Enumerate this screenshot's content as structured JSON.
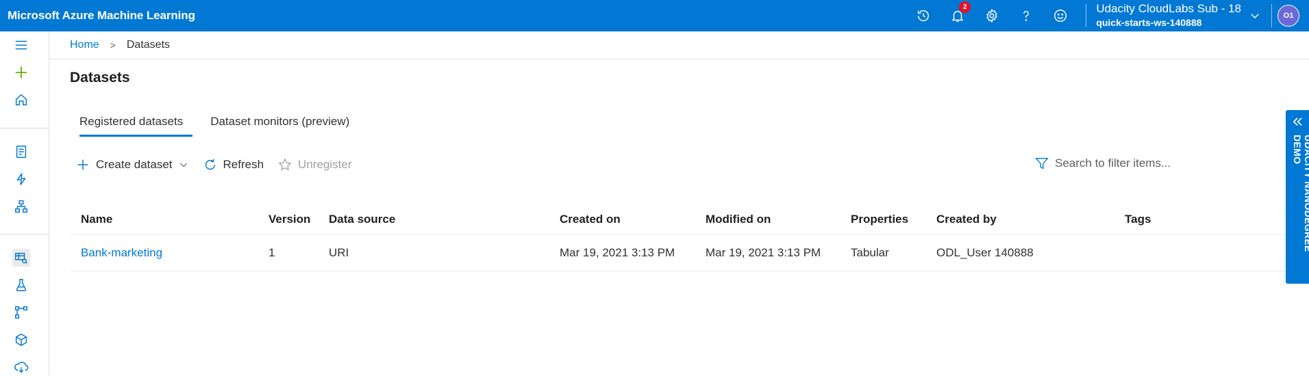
{
  "app": {
    "title": "Microsoft Azure Machine Learning"
  },
  "header": {
    "notification_count": "2",
    "account_subscription": "Udacity CloudLabs Sub - 18",
    "account_workspace": "quick-starts-ws-140888",
    "avatar_initials": "O1",
    "icons": [
      "history-icon",
      "notification-bell-icon",
      "settings-gear-icon",
      "help-question-icon",
      "feedback-smiley-icon",
      "chevron-down-icon"
    ]
  },
  "breadcrumb": {
    "home": "Home",
    "separator": ">",
    "current": "Datasets"
  },
  "page": {
    "title": "Datasets"
  },
  "tabs": [
    {
      "label": "Registered datasets",
      "active": true
    },
    {
      "label": "Dataset monitors (preview)",
      "active": false
    }
  ],
  "toolbar": {
    "create_label": "Create dataset",
    "refresh_label": "Refresh",
    "unregister_label": "Unregister"
  },
  "search": {
    "placeholder": "Search to filter items..."
  },
  "table": {
    "columns": [
      "Name",
      "Version",
      "Data source",
      "Created on",
      "Modified on",
      "Properties",
      "Created by",
      "Tags"
    ],
    "rows": [
      {
        "name": "Bank-marketing",
        "version": "1",
        "data_source": "URI",
        "created_on": "Mar 19, 2021 3:13 PM",
        "modified_on": "Mar 19, 2021 3:13 PM",
        "properties": "Tabular",
        "created_by": "ODL_User 140888",
        "tags": ""
      }
    ]
  },
  "side_panel": {
    "label": "UDACITY NANODEGREE DEMO"
  },
  "colors": {
    "brand_blue": "#0078d4",
    "badge_red": "#e81123",
    "avatar_purple": "#6b69d6",
    "plus_green": "#5db300"
  }
}
